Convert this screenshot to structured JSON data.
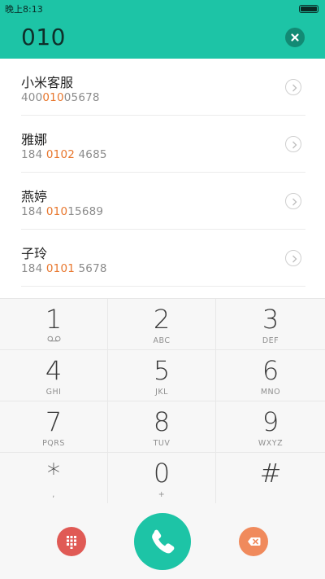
{
  "status_bar": {
    "time": "晚上8:13"
  },
  "dialer": {
    "number": "010"
  },
  "contacts": [
    {
      "name": "小米客服",
      "number_pre": "400",
      "number_match": "010",
      "number_post": "05678"
    },
    {
      "name": "雅娜",
      "number_pre": "184 ",
      "number_match": "0102",
      "number_post": " 4685"
    },
    {
      "name": "燕婷",
      "number_pre": "184 ",
      "number_match": "010",
      "number_post": "15689"
    },
    {
      "name": "子玲",
      "number_pre": "184 ",
      "number_match": "0101",
      "number_post": " 5678"
    }
  ],
  "keypad": {
    "keys": [
      {
        "digit": "1",
        "letters": ""
      },
      {
        "digit": "2",
        "letters": "ABC"
      },
      {
        "digit": "3",
        "letters": "DEF"
      },
      {
        "digit": "4",
        "letters": "GHI"
      },
      {
        "digit": "5",
        "letters": "JKL"
      },
      {
        "digit": "6",
        "letters": "MNO"
      },
      {
        "digit": "7",
        "letters": "PQRS"
      },
      {
        "digit": "8",
        "letters": "TUV"
      },
      {
        "digit": "9",
        "letters": "WXYZ"
      },
      {
        "digit": "*",
        "letters": ","
      },
      {
        "digit": "0",
        "letters": "+"
      },
      {
        "digit": "#",
        "letters": ""
      }
    ]
  },
  "colors": {
    "accent": "#1dc4a6",
    "match_highlight": "#e8762c",
    "keypad_toggle": "#e05a55",
    "backspace": "#f08a5c"
  },
  "icons": {
    "voicemail": "voicemail-icon",
    "clear": "close-icon",
    "detail": "chevron-right-icon",
    "keypad_toggle": "dialpad-icon",
    "call": "phone-icon",
    "backspace": "backspace-icon"
  }
}
